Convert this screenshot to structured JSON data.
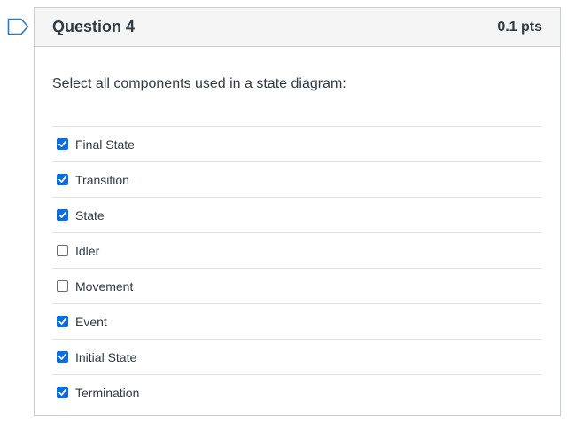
{
  "question": {
    "title": "Question 4",
    "points": "0.1 pts",
    "text": "Select all components used in a state diagram:",
    "answers": [
      {
        "label": "Final State",
        "checked": true
      },
      {
        "label": "Transition",
        "checked": true
      },
      {
        "label": "State",
        "checked": true
      },
      {
        "label": "Idler",
        "checked": false
      },
      {
        "label": "Movement",
        "checked": false
      },
      {
        "label": "Event",
        "checked": true
      },
      {
        "label": "Initial State",
        "checked": true
      },
      {
        "label": "Termination",
        "checked": true
      }
    ]
  },
  "icons": {
    "flag": "bookmark-flag-icon",
    "check": "checkmark-icon"
  },
  "colors": {
    "checkbox_checked": "#0b6ede",
    "flag_stroke": "#2b7abc",
    "header_bg": "#f5f5f5",
    "border": "#c7cdd1"
  }
}
